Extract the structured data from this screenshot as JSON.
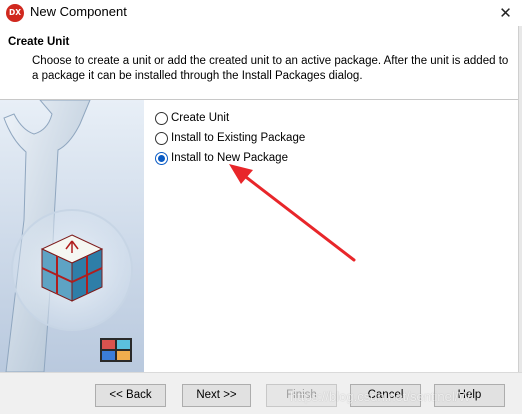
{
  "window": {
    "app_icon_text": "DX",
    "title": "New Component",
    "close_glyph": "✕"
  },
  "header": {
    "title": "Create Unit",
    "description": "Choose to create a unit or add the created unit to an active package. After the unit is added to a package it can be installed through the Install Packages dialog."
  },
  "options": [
    {
      "label": "Create Unit",
      "selected": false
    },
    {
      "label": "Install to Existing Package",
      "selected": false
    },
    {
      "label": "Install to New Package",
      "selected": true
    }
  ],
  "buttons": {
    "back": "<< Back",
    "next": "Next >>",
    "finish": "Finish",
    "cancel": "Cancel",
    "help": "Help"
  },
  "watermark": "https://blog.csdn.net/sentinel/W",
  "colors": {
    "app_icon": "#d0281e",
    "radio_accent": "#0a5bc4",
    "annotation_arrow": "#e8262a"
  },
  "icons": [
    "app-logo-icon",
    "close-icon",
    "wrench-cube-illustration",
    "component-grid-icon"
  ]
}
